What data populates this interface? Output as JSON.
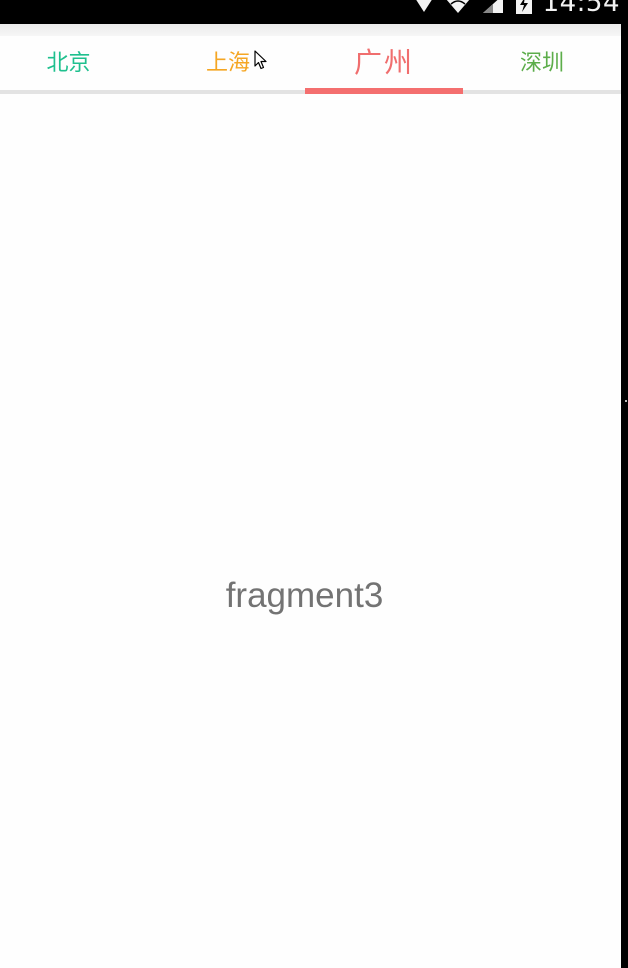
{
  "status_bar": {
    "time": "14:54",
    "icons": [
      "signal-strength-icon",
      "wifi-icon",
      "cell-signal-icon",
      "battery-charging-icon"
    ]
  },
  "tabs": [
    {
      "label": "北京",
      "color": "#1fc08e",
      "selected": false
    },
    {
      "label": "上海",
      "color": "#f5a623",
      "selected": false
    },
    {
      "label": "广州",
      "color": "#f06e6e",
      "selected": true
    },
    {
      "label": "深圳",
      "color": "#5cad4a",
      "selected": false
    }
  ],
  "indicator_color": "#f46f6f",
  "content": {
    "label": "fragment3"
  }
}
